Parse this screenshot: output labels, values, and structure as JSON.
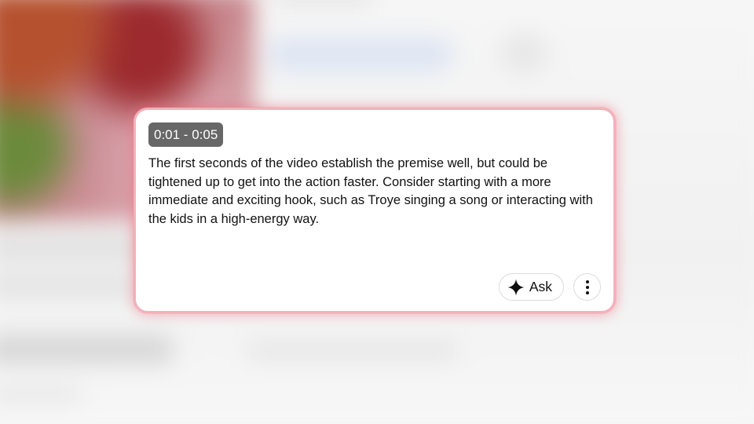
{
  "feedback_card": {
    "timestamp_range": "0:01 - 0:05",
    "body": "The first seconds of the video establish the premise well, but could be tightened up to get into the action faster. Consider starting with a more immediate and exciting hook, such as Troye singing a song or interacting with the kids in a high-energy way.",
    "ask_button": {
      "label": "Ask",
      "icon": "sparkle-icon"
    },
    "more_button": {
      "icon": "more-vertical-icon"
    },
    "accent_glow_color": "#f3b1ba",
    "chip_background_color": "#676767"
  }
}
